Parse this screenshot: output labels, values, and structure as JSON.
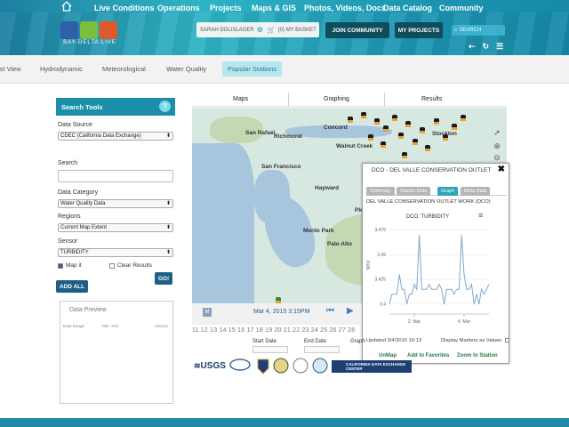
{
  "nav": {
    "items": [
      "Live Conditions",
      "Operations",
      "Projects",
      "Maps & GIS",
      "Photos, Videos, Docs",
      "Data Catalog",
      "Community"
    ]
  },
  "logo": {
    "text": "BAY-DELTA LIVE"
  },
  "header": {
    "user": "SARAH DOLISLAGER",
    "basket": "(0) MY BASKET",
    "join": "JOIN COMMUNITY",
    "projects": "MY PROJECTS",
    "search_placeholder": "SEARCH"
  },
  "tabs": [
    {
      "label": "ist View"
    },
    {
      "label": "Hydrodynamic"
    },
    {
      "label": "Meteorological"
    },
    {
      "label": "Water Quality"
    },
    {
      "label": "Popular Stations",
      "active": true
    }
  ],
  "subtabs": [
    "Maps",
    "Graphing",
    "Results"
  ],
  "search_tools": {
    "title": "Search Tools",
    "help": "?",
    "data_source_label": "Data Source",
    "data_source_value": "CDEC (California Data Exchange)",
    "search_label": "Search",
    "category_label": "Data Category",
    "category_value": "Water Quality Data",
    "regions_label": "Regions",
    "regions_value": "Current Map Extent",
    "sensor_label": "Sensor",
    "sensor_value": "TURBIDITY",
    "map_it": "Map it",
    "clear_results": "Clear Results",
    "go": "GO!",
    "add_all": "ADD ALL",
    "preview_title": "Data Preview",
    "preview_cols": [
      "Data Range",
      "Title / Info",
      "Actions"
    ]
  },
  "map": {
    "cities": [
      "Concord",
      "Richmond",
      "Stockton",
      "San Rafael",
      "Walnut Creek",
      "Hayward",
      "San Francisco",
      "Pleasanton",
      "Palo Alto",
      "Menlo Park"
    ]
  },
  "popup": {
    "title": "DCO - DEL VALLE CONSERVATION OUTLET",
    "close": "✖",
    "tabs": [
      {
        "label": "Summary"
      },
      {
        "label": "Station Data"
      },
      {
        "label": "Graph",
        "active": true
      },
      {
        "label": "Meta Data"
      }
    ],
    "subtitle": "DEL VALLE CONSERVATION OUTLET WORK (DCO)",
    "chart_menu": "≡",
    "updated": "Updated 3/4/2015 16:13",
    "display_values": "Display Markers as Values",
    "links": [
      "UnMap",
      "Add to Favorites",
      "Zoom to Station"
    ]
  },
  "chart_data": {
    "type": "line",
    "title": "DCO: TURBIDITY",
    "ylabel": "NTU",
    "ylim": [
      3.39,
      3.48
    ],
    "yticks": [
      3.4,
      3.425,
      3.45,
      3.475
    ],
    "ytick_labels": [
      "3.4",
      "3.425",
      "3.45",
      "3.475"
    ],
    "xticks": [
      "2. Mar",
      "4. Mar"
    ],
    "xtick_pos": [
      0.25,
      0.75
    ],
    "series": [
      {
        "color": "#7fa8cc",
        "values": [
          3.4,
          3.41,
          3.41,
          3.41,
          3.43,
          3.415,
          3.415,
          3.4,
          3.41,
          3.41,
          3.42,
          3.415,
          3.47,
          3.415,
          3.415,
          3.415,
          3.42,
          3.415,
          3.415,
          3.415,
          3.42,
          3.415,
          3.4,
          3.415,
          3.415,
          3.415,
          3.41,
          3.415,
          3.415,
          3.47,
          3.43,
          3.415,
          3.415,
          3.42,
          3.4,
          3.41,
          3.4,
          3.415,
          3.41,
          3.415,
          3.42
        ]
      }
    ]
  },
  "timebar": {
    "m": "M",
    "date": "Mar 4, 2015 3:15PM",
    "numbers": "11 12 13 14 15 16 17 18 19 20 21 22 23 24 25 26 27 28",
    "start_label": "Start Date",
    "end_label": "End Date",
    "graph_label": "Graph"
  },
  "logos": {
    "usgs": "USGS",
    "cdec": "CALIFORNIA DATA EXCHANGE CENTER"
  }
}
